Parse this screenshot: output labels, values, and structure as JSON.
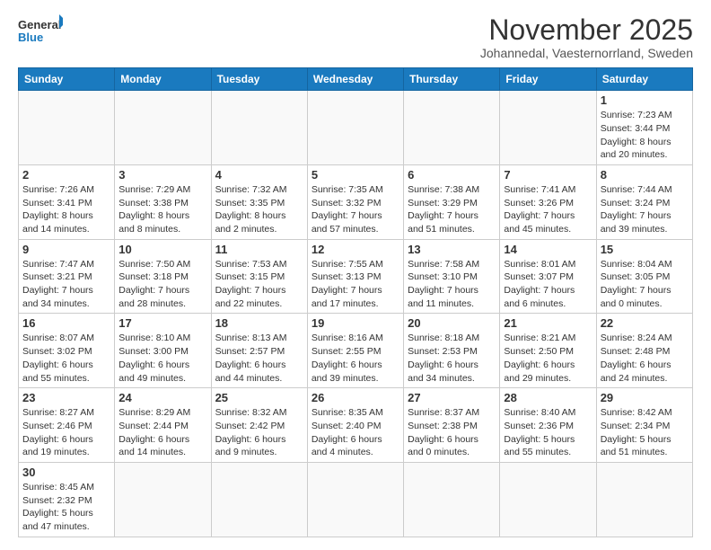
{
  "header": {
    "logo_general": "General",
    "logo_blue": "Blue",
    "month_title": "November 2025",
    "location": "Johannedal, Vaesternorrland, Sweden"
  },
  "weekdays": [
    "Sunday",
    "Monday",
    "Tuesday",
    "Wednesday",
    "Thursday",
    "Friday",
    "Saturday"
  ],
  "weeks": [
    [
      {
        "day": "",
        "info": ""
      },
      {
        "day": "",
        "info": ""
      },
      {
        "day": "",
        "info": ""
      },
      {
        "day": "",
        "info": ""
      },
      {
        "day": "",
        "info": ""
      },
      {
        "day": "",
        "info": ""
      },
      {
        "day": "1",
        "info": "Sunrise: 7:23 AM\nSunset: 3:44 PM\nDaylight: 8 hours\nand 20 minutes."
      }
    ],
    [
      {
        "day": "2",
        "info": "Sunrise: 7:26 AM\nSunset: 3:41 PM\nDaylight: 8 hours\nand 14 minutes."
      },
      {
        "day": "3",
        "info": "Sunrise: 7:29 AM\nSunset: 3:38 PM\nDaylight: 8 hours\nand 8 minutes."
      },
      {
        "day": "4",
        "info": "Sunrise: 7:32 AM\nSunset: 3:35 PM\nDaylight: 8 hours\nand 2 minutes."
      },
      {
        "day": "5",
        "info": "Sunrise: 7:35 AM\nSunset: 3:32 PM\nDaylight: 7 hours\nand 57 minutes."
      },
      {
        "day": "6",
        "info": "Sunrise: 7:38 AM\nSunset: 3:29 PM\nDaylight: 7 hours\nand 51 minutes."
      },
      {
        "day": "7",
        "info": "Sunrise: 7:41 AM\nSunset: 3:26 PM\nDaylight: 7 hours\nand 45 minutes."
      },
      {
        "day": "8",
        "info": "Sunrise: 7:44 AM\nSunset: 3:24 PM\nDaylight: 7 hours\nand 39 minutes."
      }
    ],
    [
      {
        "day": "9",
        "info": "Sunrise: 7:47 AM\nSunset: 3:21 PM\nDaylight: 7 hours\nand 34 minutes."
      },
      {
        "day": "10",
        "info": "Sunrise: 7:50 AM\nSunset: 3:18 PM\nDaylight: 7 hours\nand 28 minutes."
      },
      {
        "day": "11",
        "info": "Sunrise: 7:53 AM\nSunset: 3:15 PM\nDaylight: 7 hours\nand 22 minutes."
      },
      {
        "day": "12",
        "info": "Sunrise: 7:55 AM\nSunset: 3:13 PM\nDaylight: 7 hours\nand 17 minutes."
      },
      {
        "day": "13",
        "info": "Sunrise: 7:58 AM\nSunset: 3:10 PM\nDaylight: 7 hours\nand 11 minutes."
      },
      {
        "day": "14",
        "info": "Sunrise: 8:01 AM\nSunset: 3:07 PM\nDaylight: 7 hours\nand 6 minutes."
      },
      {
        "day": "15",
        "info": "Sunrise: 8:04 AM\nSunset: 3:05 PM\nDaylight: 7 hours\nand 0 minutes."
      }
    ],
    [
      {
        "day": "16",
        "info": "Sunrise: 8:07 AM\nSunset: 3:02 PM\nDaylight: 6 hours\nand 55 minutes."
      },
      {
        "day": "17",
        "info": "Sunrise: 8:10 AM\nSunset: 3:00 PM\nDaylight: 6 hours\nand 49 minutes."
      },
      {
        "day": "18",
        "info": "Sunrise: 8:13 AM\nSunset: 2:57 PM\nDaylight: 6 hours\nand 44 minutes."
      },
      {
        "day": "19",
        "info": "Sunrise: 8:16 AM\nSunset: 2:55 PM\nDaylight: 6 hours\nand 39 minutes."
      },
      {
        "day": "20",
        "info": "Sunrise: 8:18 AM\nSunset: 2:53 PM\nDaylight: 6 hours\nand 34 minutes."
      },
      {
        "day": "21",
        "info": "Sunrise: 8:21 AM\nSunset: 2:50 PM\nDaylight: 6 hours\nand 29 minutes."
      },
      {
        "day": "22",
        "info": "Sunrise: 8:24 AM\nSunset: 2:48 PM\nDaylight: 6 hours\nand 24 minutes."
      }
    ],
    [
      {
        "day": "23",
        "info": "Sunrise: 8:27 AM\nSunset: 2:46 PM\nDaylight: 6 hours\nand 19 minutes."
      },
      {
        "day": "24",
        "info": "Sunrise: 8:29 AM\nSunset: 2:44 PM\nDaylight: 6 hours\nand 14 minutes."
      },
      {
        "day": "25",
        "info": "Sunrise: 8:32 AM\nSunset: 2:42 PM\nDaylight: 6 hours\nand 9 minutes."
      },
      {
        "day": "26",
        "info": "Sunrise: 8:35 AM\nSunset: 2:40 PM\nDaylight: 6 hours\nand 4 minutes."
      },
      {
        "day": "27",
        "info": "Sunrise: 8:37 AM\nSunset: 2:38 PM\nDaylight: 6 hours\nand 0 minutes."
      },
      {
        "day": "28",
        "info": "Sunrise: 8:40 AM\nSunset: 2:36 PM\nDaylight: 5 hours\nand 55 minutes."
      },
      {
        "day": "29",
        "info": "Sunrise: 8:42 AM\nSunset: 2:34 PM\nDaylight: 5 hours\nand 51 minutes."
      }
    ],
    [
      {
        "day": "30",
        "info": "Sunrise: 8:45 AM\nSunset: 2:32 PM\nDaylight: 5 hours\nand 47 minutes."
      },
      {
        "day": "",
        "info": ""
      },
      {
        "day": "",
        "info": ""
      },
      {
        "day": "",
        "info": ""
      },
      {
        "day": "",
        "info": ""
      },
      {
        "day": "",
        "info": ""
      },
      {
        "day": "",
        "info": ""
      }
    ]
  ]
}
